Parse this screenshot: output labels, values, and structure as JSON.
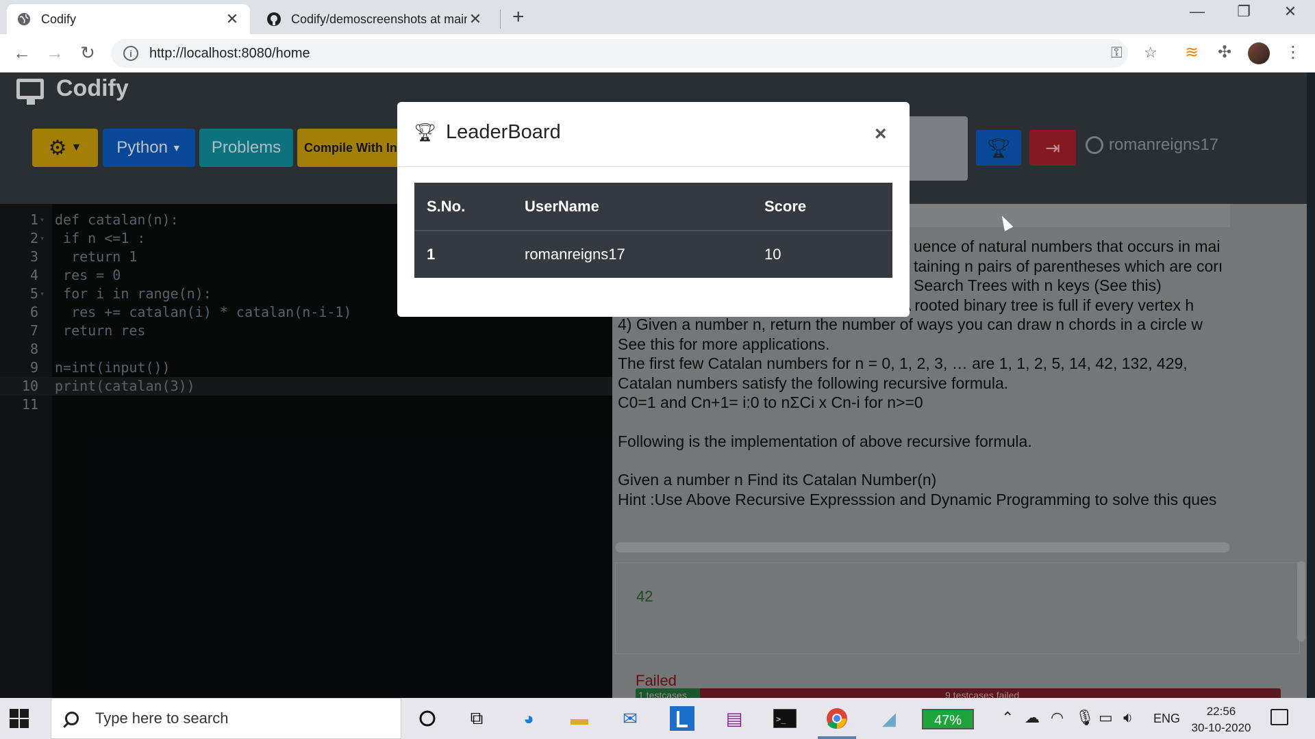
{
  "browser": {
    "tabs": [
      {
        "title": "Codify",
        "icon": "globe-icon",
        "active": true
      },
      {
        "title": "Codify/demoscreenshots at main",
        "icon": "github-icon",
        "active": false
      }
    ],
    "new_tab": "+",
    "url": "http://localhost:8080/home",
    "window_controls": {
      "minimize": "—",
      "maximize": "❐",
      "close": "✕"
    }
  },
  "app": {
    "brand": "Codify",
    "nav": {
      "settings_icon": "gear-icon",
      "language": "Python",
      "problems": "Problems",
      "compile": "Compile With In"
    },
    "username": "romanreigns17"
  },
  "editor": {
    "current_line": 10,
    "lines": [
      {
        "n": "1",
        "fold": "▾",
        "code": "def catalan(n):"
      },
      {
        "n": "2",
        "fold": "▾",
        "code": " if n <=1 :"
      },
      {
        "n": "3",
        "fold": "",
        "code": "  return 1"
      },
      {
        "n": "4",
        "fold": "",
        "code": " res = 0"
      },
      {
        "n": "5",
        "fold": "▾",
        "code": " for i in range(n):"
      },
      {
        "n": "6",
        "fold": "",
        "code": "  res += catalan(i) * catalan(n-i-1)"
      },
      {
        "n": "7",
        "fold": "",
        "code": " return res"
      },
      {
        "n": "8",
        "fold": "",
        "code": ""
      },
      {
        "n": "9",
        "fold": "",
        "code": "n=int(input())"
      },
      {
        "n": "10",
        "fold": "",
        "code": "print(catalan(3))"
      },
      {
        "n": "11",
        "fold": "",
        "code": ""
      }
    ]
  },
  "problem": {
    "lines": [
      "uence of natural numbers that occurs in mai",
      "taining n pairs of parentheses which are corı",
      "Search Trees with n keys (See this)",
      "3) Count the number of full binary trees (A rooted binary tree is full if every vertex h",
      "4) Given a number n, return the number of ways you can draw n chords in a circle w",
      "See this for more applications.",
      "The first few Catalan numbers for n = 0, 1, 2, 3, … are 1, 1, 2, 5, 14, 42, 132, 429,",
      "Catalan numbers satisfy the following recursive formula.",
      "C0=1 and Cn+1= i:0 to nΣCi x Cn-i  for n>=0",
      "",
      "Following is the implementation of above recursive formula.",
      "",
      "Given a number n Find its Catalan Number(n)",
      "Hint :Use Above Recursive Expresssion and Dynamic Programming to solve this ques"
    ]
  },
  "output": {
    "value": "42"
  },
  "result": {
    "status": "Failed",
    "passed_label": "1 testcases",
    "failed_label": "9 testcases failed",
    "pass_fraction": 0.1
  },
  "leaderboard": {
    "title": "LeaderBoard",
    "close": "×",
    "columns": [
      "S.No.",
      "UserName",
      "Score"
    ],
    "rows": [
      {
        "sno": "1",
        "username": "romanreigns17",
        "score": "10"
      }
    ]
  },
  "taskbar": {
    "search_placeholder": "Type here to search",
    "battery": "47%",
    "language": "ENG",
    "time": "22:56",
    "date": "30-10-2020"
  }
}
